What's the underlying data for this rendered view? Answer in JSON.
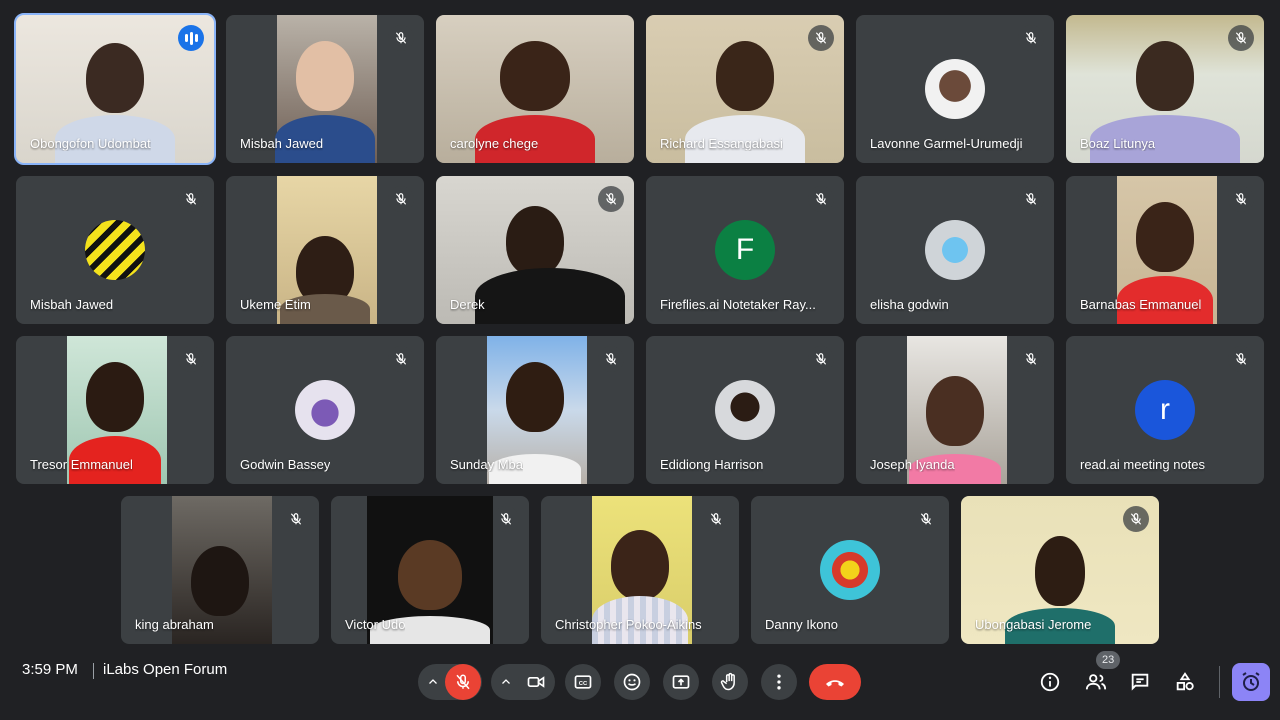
{
  "participants": [
    {
      "name": "Obongofon Udombat",
      "speaking": true
    },
    {
      "name": "Misbah Jawed"
    },
    {
      "name": "carolyne chege"
    },
    {
      "name": "Richard Essangabasi"
    },
    {
      "name": "Lavonne Garmel-Urumedji"
    },
    {
      "name": "Boaz Litunya"
    },
    {
      "name": "Misbah Jawed"
    },
    {
      "name": "Ukeme Etim"
    },
    {
      "name": "Derek"
    },
    {
      "name": "Fireflies.ai Notetaker Ray...",
      "avatar_letter": "F"
    },
    {
      "name": "elisha godwin"
    },
    {
      "name": "Barnabas Emmanuel"
    },
    {
      "name": "Tresor Emmanuel"
    },
    {
      "name": "Godwin Bassey"
    },
    {
      "name": "Sunday Mba"
    },
    {
      "name": "Edidiong Harrison"
    },
    {
      "name": "Joseph Iyanda"
    },
    {
      "name": "read.ai meeting notes",
      "avatar_letter": "r"
    },
    {
      "name": "king abraham"
    },
    {
      "name": "Victor Udo"
    },
    {
      "name": "Christopher Pokoo-Aikins"
    },
    {
      "name": "Danny Ikono"
    },
    {
      "name": "Ubongabasi Jerome"
    }
  ],
  "bottom_bar": {
    "time": "3:59 PM",
    "meeting_name": "iLabs Open Forum",
    "people_count": "23"
  },
  "colors": {
    "background": "#202124",
    "tile": "#3c4043",
    "hangup": "#ea4335",
    "activities": "#8c84f6",
    "speaking_outline": "#8ab4f8"
  },
  "icons": {
    "mute": "mic-off-icon",
    "speaking": "audio-level-icon",
    "mic": "mic-off-icon",
    "camera": "videocam-icon",
    "captions": "closed-captions-icon",
    "emoji": "emoji-icon",
    "present": "present-screen-icon",
    "raise_hand": "hand-icon",
    "more": "more-vert-icon",
    "hangup": "call-end-icon",
    "info": "info-icon",
    "people": "people-icon",
    "chat": "chat-icon",
    "activities_shapes": "shapes-icon",
    "host": "host-controls-icon"
  }
}
